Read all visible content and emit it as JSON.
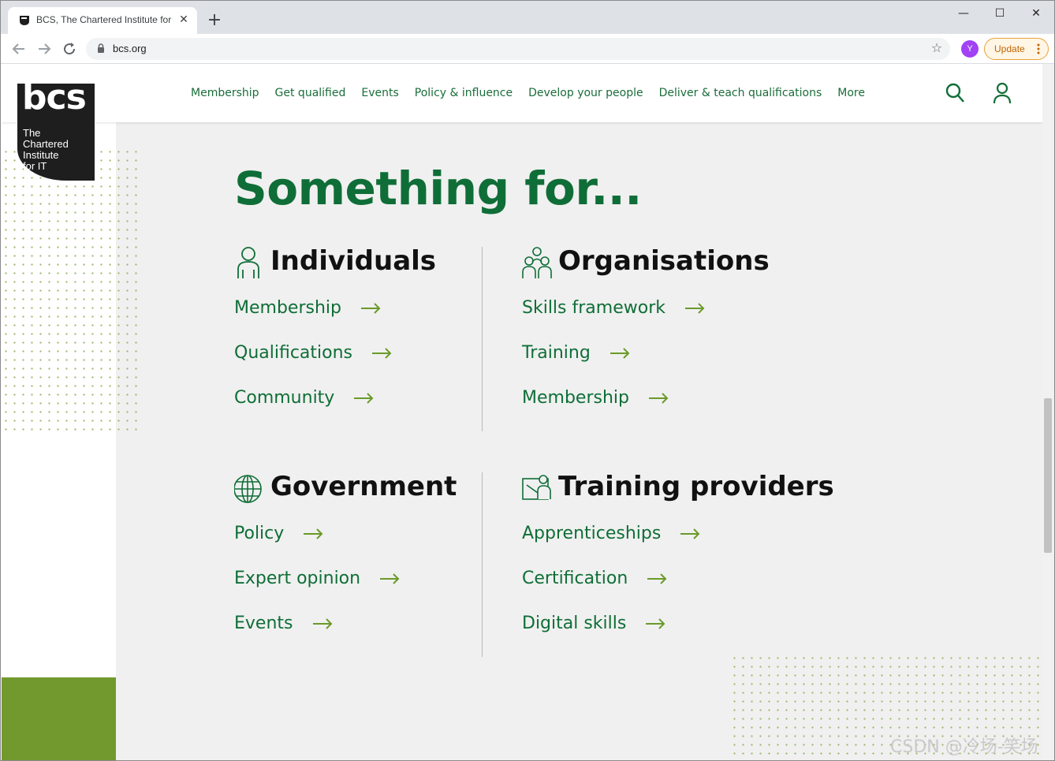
{
  "browser": {
    "tab_title": "BCS, The Chartered Institute for IT",
    "tab_close": "✕",
    "new_tab": "+",
    "url": "bcs.org",
    "profile_initial": "Y",
    "update_label": "Update",
    "window_minimize": "—",
    "window_maximize": "☐",
    "window_close": "✕",
    "star": "☆"
  },
  "header": {
    "logo_mark": "bcs",
    "logo_lines": [
      "The",
      "Chartered",
      "Institute",
      "for IT"
    ],
    "nav": [
      "Membership",
      "Get qualified",
      "Events",
      "Policy & influence",
      "Develop your people",
      "Deliver & teach qualifications",
      "More"
    ]
  },
  "hero": {
    "title": "Something for..."
  },
  "sections": [
    {
      "title": "Individuals",
      "icon": "person-icon",
      "links": [
        "Membership",
        "Qualifications",
        "Community"
      ]
    },
    {
      "title": "Organisations",
      "icon": "group-icon",
      "links": [
        "Skills framework",
        "Training",
        "Membership"
      ]
    },
    {
      "title": "Government",
      "icon": "globe-icon",
      "links": [
        "Policy",
        "Expert opinion",
        "Events"
      ]
    },
    {
      "title": "Training providers",
      "icon": "trainer-board-icon",
      "links": [
        "Apprenticeships",
        "Certification",
        "Digital skills"
      ]
    }
  ],
  "colors": {
    "brand_green": "#0f6e37",
    "accent_green": "#72992d",
    "arrow_green": "#6a9a2a",
    "background": "#f0f0f0"
  },
  "watermark": "CSDN @冷场-笑场"
}
